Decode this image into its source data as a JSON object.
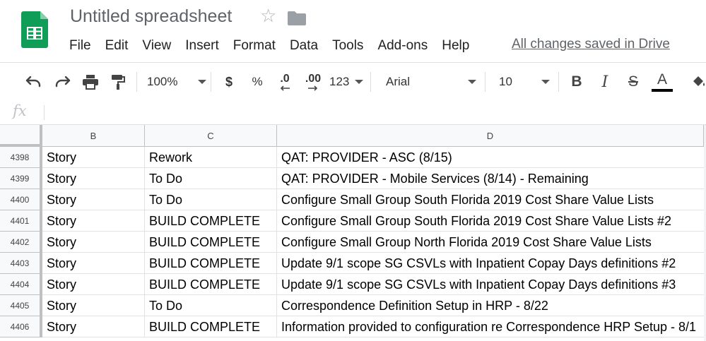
{
  "app": {
    "title": "Untitled spreadsheet",
    "saved_status": "All changes saved in Drive",
    "icons": {
      "logo": "sheets-logo-icon",
      "star": "star-outline-icon",
      "folder": "folder-icon"
    }
  },
  "menu": [
    "File",
    "Edit",
    "View",
    "Insert",
    "Format",
    "Data",
    "Tools",
    "Add-ons",
    "Help"
  ],
  "toolbar": {
    "zoom": "100%",
    "currency": "$",
    "percent": "%",
    "decrease_decimal": ".0",
    "increase_decimal": ".00",
    "more_formats": "123",
    "font": "Arial",
    "font_size": "10",
    "bold": "B",
    "italic": "I",
    "strikethrough": "S",
    "text_color": "A"
  },
  "formula_bar": {
    "label": "fx",
    "value": ""
  },
  "columns": [
    "B",
    "C",
    "D"
  ],
  "rows": [
    {
      "num": "4398",
      "b": "Story",
      "c": "Rework",
      "d": "QAT:  PROVIDER - ASC (8/15)"
    },
    {
      "num": "4399",
      "b": "Story",
      "c": "To Do",
      "d": "QAT:  PROVIDER - Mobile Services (8/14) - Remaining"
    },
    {
      "num": "4400",
      "b": "Story",
      "c": "To Do",
      "d": "Configure Small Group South Florida 2019 Cost Share Value Lists"
    },
    {
      "num": "4401",
      "b": "Story",
      "c": "BUILD COMPLETE",
      "d": "Configure Small Group South Florida 2019 Cost Share Value Lists #2"
    },
    {
      "num": "4402",
      "b": "Story",
      "c": "BUILD COMPLETE",
      "d": "Configure Small Group North Florida 2019 Cost Share Value Lists"
    },
    {
      "num": "4403",
      "b": "Story",
      "c": "BUILD COMPLETE",
      "d": "Update 9/1 scope SG CSVLs with Inpatient Copay Days definitions #2"
    },
    {
      "num": "4404",
      "b": "Story",
      "c": "BUILD COMPLETE",
      "d": "Update 9/1 scope SG CSVLs with Inpatient Copay Days definitions #3"
    },
    {
      "num": "4405",
      "b": "Story",
      "c": "To Do",
      "d": "Correspondence Definition Setup in HRP - 8/22"
    },
    {
      "num": "4406",
      "b": "Story",
      "c": "BUILD COMPLETE",
      "d": "Information provided to configuration re Correspondence HRP Setup - 8/1"
    }
  ],
  "colors": {
    "sheets_green": "#0f9d58",
    "header_gray": "#f8f9fa",
    "grid_line": "#e2e2e2"
  }
}
